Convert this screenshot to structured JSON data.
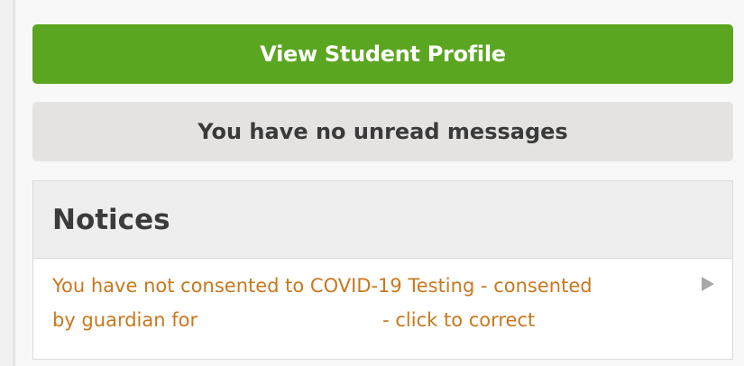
{
  "buttons": {
    "view_profile_label": "View Student Profile"
  },
  "messages": {
    "status_text": "You have no unread messages"
  },
  "notices": {
    "title": "Notices",
    "items": [
      {
        "line1": "You have not consented to COVID-19 Testing - consented",
        "line2_prefix": "by guardian for",
        "line2_suffix": "- click to correct"
      }
    ]
  },
  "colors": {
    "primary_button": "#5aa620",
    "notice_text": "#c9781d",
    "message_bg": "#e4e3e2"
  },
  "icons": {
    "notice_arrow": "play-arrow-icon"
  }
}
